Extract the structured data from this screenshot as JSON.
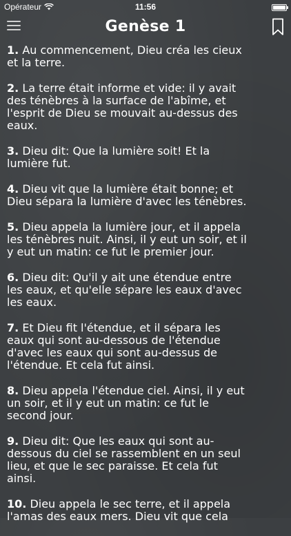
{
  "status_bar": {
    "carrier": "Opérateur",
    "time": "11:56"
  },
  "nav": {
    "title": "Genèse 1"
  },
  "verses": [
    {
      "num": "1.",
      "lines": [
        "Au commencement, Dieu créa les cieux",
        "et la terre."
      ]
    },
    {
      "num": "2.",
      "lines": [
        "La terre était informe et vide: il y avait",
        "des ténèbres à la surface de l'abîme, et",
        "l'esprit de Dieu se mouvait au-dessus des",
        "eaux."
      ]
    },
    {
      "num": "3.",
      "lines": [
        "Dieu dit: Que la lumière soit! Et la",
        "lumière fut."
      ]
    },
    {
      "num": "4.",
      "lines": [
        "Dieu vit que la lumière était bonne; et",
        "Dieu sépara la lumière d'avec les ténèbres."
      ]
    },
    {
      "num": "5.",
      "lines": [
        "Dieu appela la lumière jour, et il appela",
        "les ténèbres nuit. Ainsi, il y eut un soir, et il",
        "y eut un matin: ce fut le premier jour."
      ]
    },
    {
      "num": "6.",
      "lines": [
        "Dieu dit: Qu'il y ait une étendue entre",
        "les eaux, et qu'elle sépare les eaux d'avec",
        "les eaux."
      ]
    },
    {
      "num": "7.",
      "lines": [
        "Et Dieu fit l'étendue, et il sépara les",
        "eaux qui sont au-dessous de l'étendue",
        "d'avec les eaux qui sont au-dessus de",
        "l'étendue. Et cela fut ainsi."
      ]
    },
    {
      "num": "8.",
      "lines": [
        "Dieu appela l'étendue ciel. Ainsi, il y eut",
        "un soir, et il y eut un matin: ce fut le",
        "second jour."
      ]
    },
    {
      "num": "9.",
      "lines": [
        "Dieu dit: Que les eaux qui sont au-",
        "dessous du ciel se rassemblent en un seul",
        "lieu, et que le sec paraisse. Et cela fut",
        "ainsi."
      ]
    },
    {
      "num": "10.",
      "lines": [
        "Dieu appela le sec terre, et il appela",
        "l'amas des eaux mers. Dieu vit que cela"
      ]
    }
  ]
}
